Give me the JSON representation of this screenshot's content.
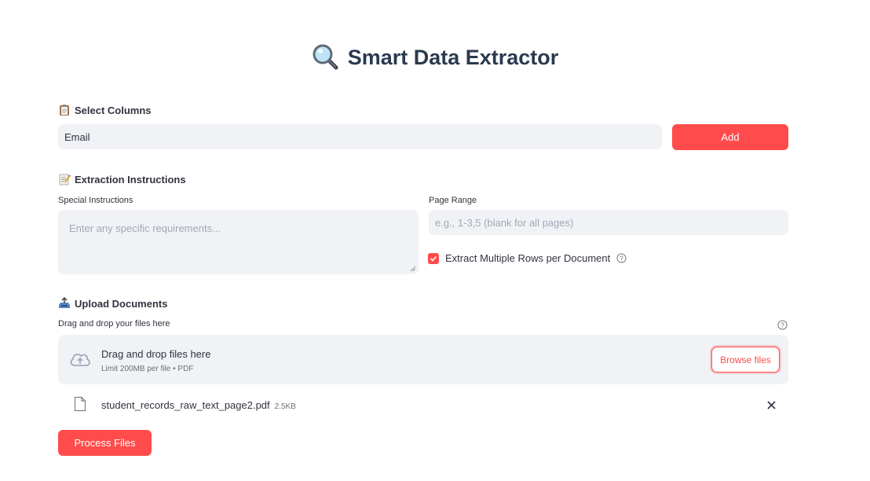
{
  "app": {
    "title": "Smart Data Extractor",
    "title_icon": "magnifying-glass-icon"
  },
  "select_columns": {
    "heading": "Select Columns",
    "heading_icon": "clipboard-icon",
    "input_value": "Email",
    "add_label": "Add"
  },
  "extraction": {
    "heading": "Extraction Instructions",
    "heading_icon": "memo-icon",
    "special_label": "Special Instructions",
    "special_placeholder": "Enter any specific requirements...",
    "page_range_label": "Page Range",
    "page_range_placeholder": "e.g., 1-3,5 (blank for all pages)",
    "multi_rows_label": "Extract Multiple Rows per Document",
    "multi_rows_checked": true
  },
  "upload": {
    "heading": "Upload Documents",
    "heading_icon": "inbox-tray-icon",
    "drag_label": "Drag and drop your files here",
    "dropzone_title": "Drag and drop files here",
    "dropzone_limit": "Limit 200MB per file • PDF",
    "browse_label": "Browse files",
    "files": [
      {
        "name": "student_records_raw_text_page2.pdf",
        "size": "2.5KB"
      }
    ]
  },
  "actions": {
    "process_label": "Process Files"
  },
  "colors": {
    "accent": "#ff4b4b",
    "input_bg": "#f0f2f6",
    "title": "#2b3a4e"
  }
}
